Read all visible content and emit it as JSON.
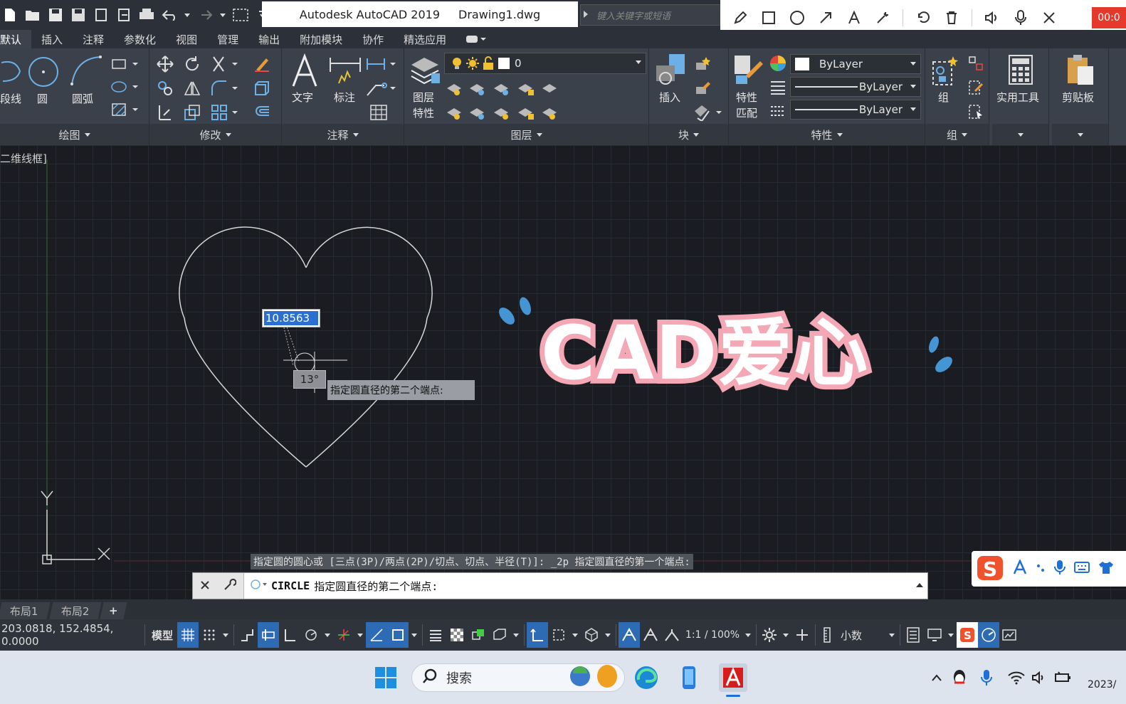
{
  "window": {
    "app_title": "Autodesk AutoCAD 2019",
    "file_name": "Drawing1.dwg",
    "search_placeholder": "键入关键字或短语"
  },
  "recorder": {
    "timer": "00:0"
  },
  "ribbon_tabs": [
    "默认",
    "插入",
    "注释",
    "参数化",
    "视图",
    "管理",
    "输出",
    "附加模块",
    "协作",
    "精选应用"
  ],
  "panels": {
    "draw": {
      "footer": "绘图",
      "polyline": "段线",
      "circle": "圆",
      "arc": "圆弧"
    },
    "modify": {
      "footer": "修改"
    },
    "annotation": {
      "footer": "注释",
      "text": "文字",
      "dimension": "标注"
    },
    "layers": {
      "footer": "图层",
      "layer_props_1": "图层",
      "layer_props_2": "特性",
      "current_layer": "0"
    },
    "block": {
      "footer": "块",
      "insert": "插入"
    },
    "properties": {
      "footer": "特性",
      "match_1": "特性",
      "match_2": "匹配",
      "color": "ByLayer",
      "linetype": "ByLayer",
      "lineweight": "ByLayer"
    },
    "group": {
      "footer": "组",
      "group": "组"
    },
    "utilities": {
      "label": "实用工具"
    },
    "clipboard": {
      "label": "剪贴板"
    }
  },
  "viewport": {
    "view_label": "二维线框]",
    "dynamic_input_value": "10.8563",
    "angle_value": "13°",
    "prompt_tooltip": "指定圆直径的第二个端点:",
    "ucs_x": "X",
    "ucs_y": "Y"
  },
  "overlay": {
    "title_text": "CAD爱心"
  },
  "command": {
    "history": "指定圆的圆心或 [三点(3P)/两点(2P)/切点、切点、半径(T)]: _2p 指定圆直径的第一个端点:",
    "current_command": "CIRCLE",
    "current_prompt": "指定圆直径的第二个端点:"
  },
  "layout_tabs": [
    "布局1",
    "布局2",
    "+"
  ],
  "status_bar": {
    "coordinates": "203.0818, 152.4854, 0.0000",
    "model": "模型",
    "scale": "1:1 / 100%",
    "units": "小数"
  },
  "taskbar": {
    "search_label": "搜索",
    "date_partial": "2023/"
  },
  "colors": {
    "accent_blue": "#2d6bb5",
    "recorder_red": "#e53a2b",
    "overlay_pink": "#f4a7b4",
    "cad_canvas": "#1a1c21"
  }
}
